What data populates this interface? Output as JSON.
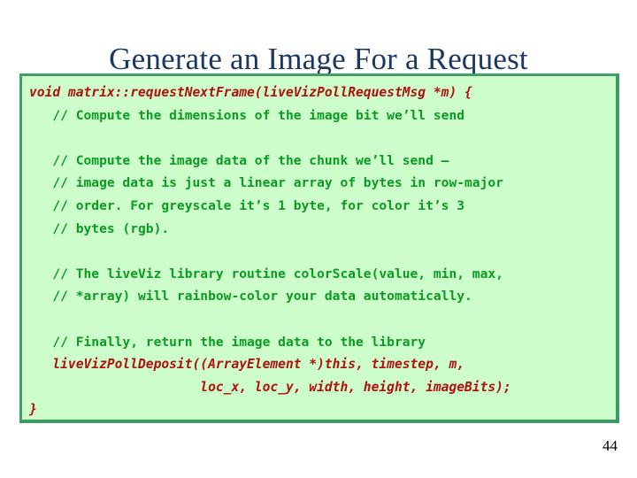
{
  "slide": {
    "title": "Generate an Image For a Request",
    "page_number": "44",
    "colors": {
      "background": "#ffffff",
      "title_text": "#1b3861",
      "code_box_fill": "#ccfdcb",
      "code_box_border": "#41a067",
      "code_text": "#b11010",
      "comment_text": "#0a9c20"
    }
  },
  "code_block": {
    "lines": [
      {
        "kind": "code",
        "text": "void matrix::requestNextFrame(liveVizPollRequestMsg *m) {"
      },
      {
        "kind": "comment",
        "text": "   // Compute the dimensions of the image bit we’ll send"
      },
      {
        "kind": "blank",
        "text": " "
      },
      {
        "kind": "comment",
        "text": "   // Compute the image data of the chunk we’ll send –"
      },
      {
        "kind": "comment",
        "text": "   // image data is just a linear array of bytes in row-major"
      },
      {
        "kind": "comment",
        "text": "   // order. For greyscale it’s 1 byte, for color it’s 3"
      },
      {
        "kind": "comment",
        "text": "   // bytes (rgb)."
      },
      {
        "kind": "blank",
        "text": " "
      },
      {
        "kind": "comment",
        "text": "   // The liveViz library routine colorScale(value, min, max,"
      },
      {
        "kind": "comment",
        "text": "   // *array) will rainbow-color your data automatically."
      },
      {
        "kind": "blank",
        "text": " "
      },
      {
        "kind": "comment",
        "text": "   // Finally, return the image data to the library"
      },
      {
        "kind": "code",
        "text": "   liveVizPollDeposit((ArrayElement *)this, timestep, m,"
      },
      {
        "kind": "code",
        "text": "                      loc_x, loc_y, width, height, imageBits);"
      },
      {
        "kind": "code",
        "text": "}"
      }
    ]
  }
}
